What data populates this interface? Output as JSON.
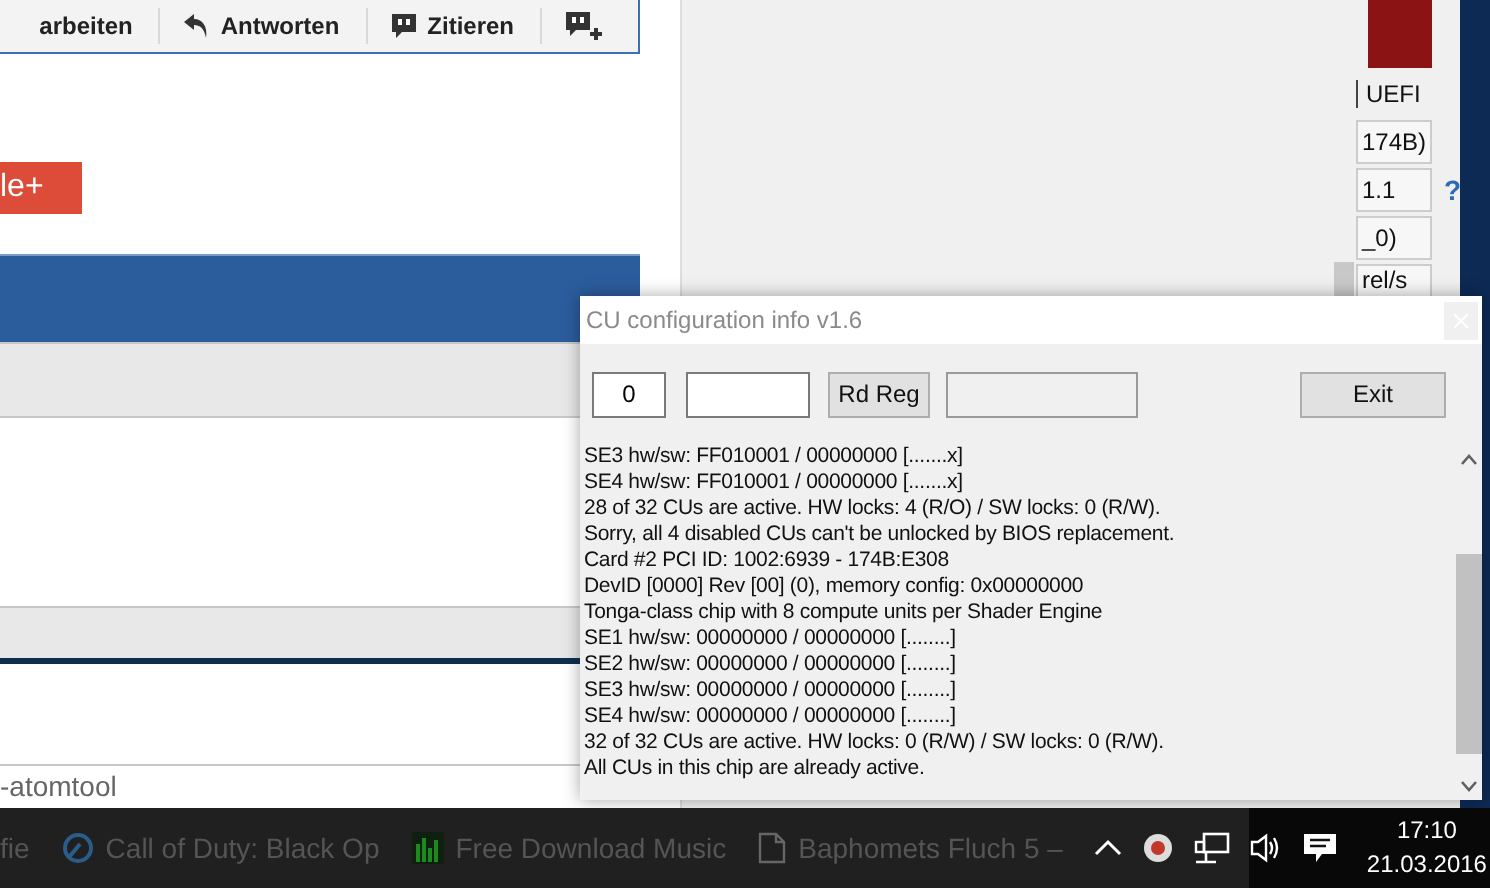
{
  "browser": {
    "toolbar": [
      {
        "label": "arbeiten"
      },
      {
        "label": "Antworten"
      },
      {
        "label": "Zitieren"
      }
    ],
    "share_button": "le+",
    "address_text": "-atomtool"
  },
  "gpu_tool": {
    "fields": [
      {
        "value": "UEFI",
        "kind": "label"
      },
      {
        "value": "174B)",
        "kind": "field"
      },
      {
        "value": "1.1",
        "kind": "field"
      },
      {
        "value": "_0)",
        "kind": "field"
      },
      {
        "value": "rel/s",
        "kind": "field"
      }
    ],
    "help": "?"
  },
  "dialog": {
    "title": "CU configuration info v1.6",
    "index_value": "0",
    "read_button": "Rd Reg",
    "exit_button": "Exit",
    "log": [
      "SE3 hw/sw: FF010001 / 00000000 [.......x]",
      "SE4 hw/sw: FF010001 / 00000000 [.......x]",
      "28 of 32 CUs are active. HW locks: 4 (R/O) / SW locks: 0 (R/W).",
      "Sorry, all 4 disabled CUs can't be unlocked by BIOS replacement.",
      "Card #2 PCI ID: 1002:6939 - 174B:E308",
      "DevID [0000] Rev [00] (0), memory config: 0x00000000",
      "Tonga-class chip with 8 compute units per Shader Engine",
      "SE1 hw/sw: 00000000 / 00000000 [........]",
      "SE2 hw/sw: 00000000 / 00000000 [........]",
      "SE3 hw/sw: 00000000 / 00000000 [........]",
      "SE4 hw/sw: 00000000 / 00000000 [........]",
      "32 of 32 CUs are active. HW locks: 0 (R/W) / SW locks: 0 (R/W).",
      "All CUs in this chip are already active."
    ]
  },
  "taskbar": {
    "items": [
      {
        "label": "fie"
      },
      {
        "label": "Call of Duty: Black Op"
      },
      {
        "label": "Free Download Music"
      },
      {
        "label": "Baphomets Fluch 5 –"
      }
    ],
    "time": "17:10",
    "date": "21.03.2016"
  }
}
